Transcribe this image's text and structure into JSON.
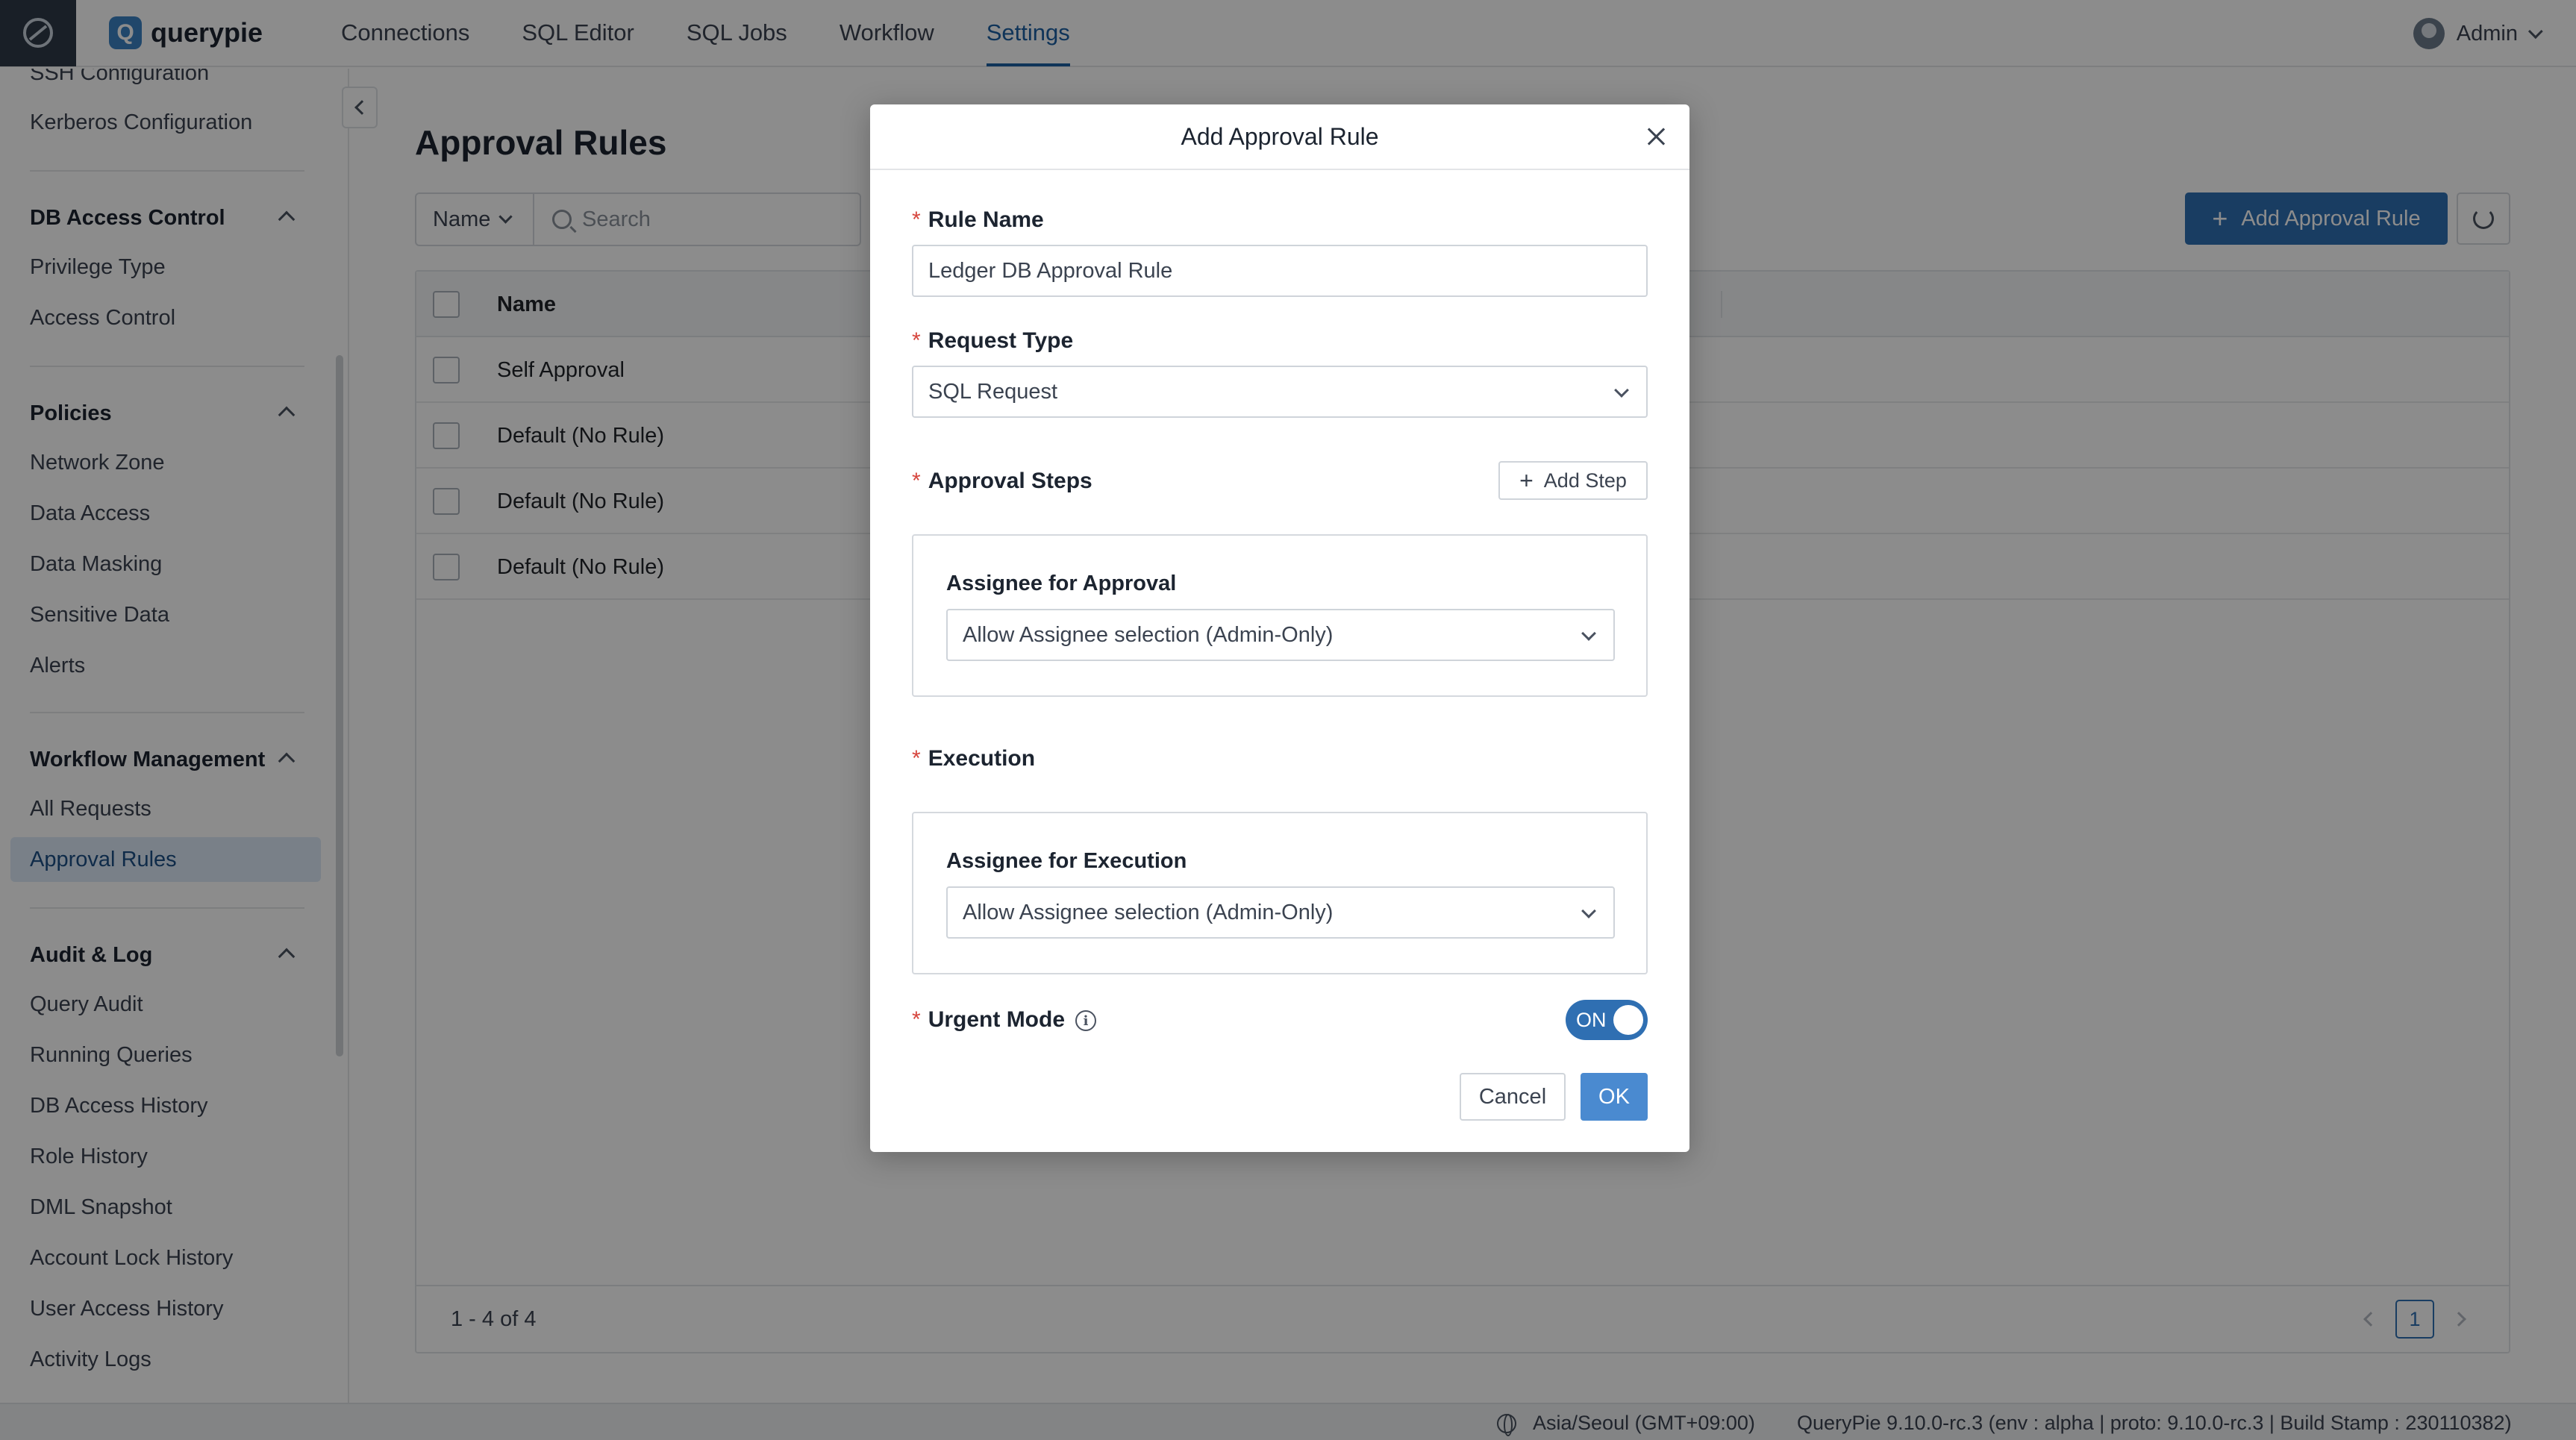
{
  "brand": {
    "name": "querypie",
    "logo_letter": "Q"
  },
  "nav": [
    {
      "label": "Connections"
    },
    {
      "label": "SQL Editor"
    },
    {
      "label": "SQL Jobs"
    },
    {
      "label": "Workflow"
    },
    {
      "label": "Settings",
      "active": true
    }
  ],
  "user": {
    "name": "Admin"
  },
  "sidebar": {
    "top_items": [
      "SSH Configuration",
      "Kerberos Configuration"
    ],
    "sections": [
      {
        "title": "DB Access Control",
        "items": [
          "Privilege Type",
          "Access Control"
        ]
      },
      {
        "title": "Policies",
        "items": [
          "Network Zone",
          "Data Access",
          "Data Masking",
          "Sensitive Data",
          "Alerts"
        ]
      },
      {
        "title": "Workflow Management",
        "items": [
          "All Requests",
          "Approval Rules"
        ]
      },
      {
        "title": "Audit & Log",
        "items": [
          "Query Audit",
          "Running Queries",
          "DB Access History",
          "Role History",
          "DML Snapshot",
          "Account Lock History",
          "User Access History",
          "Activity Logs"
        ]
      }
    ],
    "active_item": "Approval Rules"
  },
  "main": {
    "title": "Approval Rules",
    "filter": {
      "field": "Name",
      "search_placeholder": "Search"
    },
    "add_button": "Add Approval Rule",
    "table": {
      "columns": [
        "Name"
      ],
      "rows": [
        "Self Approval",
        "Default (No Rule)",
        "Default (No Rule)",
        "Default (No Rule)"
      ]
    },
    "pagination": {
      "summary": "1 - 4 of 4",
      "current_page": "1"
    }
  },
  "status_bar": {
    "timezone": "Asia/Seoul (GMT+09:00)",
    "version": "QueryPie 9.10.0-rc.3 (env : alpha | proto: 9.10.0-rc.3 | Build Stamp : 230110382)"
  },
  "modal": {
    "title": "Add Approval Rule",
    "required_mark": "*",
    "rule_name": {
      "label": "Rule Name",
      "value": "Ledger DB Approval Rule"
    },
    "request_type": {
      "label": "Request Type",
      "value": "SQL Request"
    },
    "approval_steps": {
      "label": "Approval Steps",
      "add_step": "Add Step",
      "assignee_label": "Assignee for Approval",
      "assignee_value": "Allow Assignee selection (Admin-Only)"
    },
    "execution": {
      "label": "Execution",
      "assignee_label": "Assignee for Execution",
      "assignee_value": "Allow Assignee selection (Admin-Only)"
    },
    "urgent_mode": {
      "label": "Urgent Mode",
      "toggle_label": "ON",
      "enabled": true
    },
    "cancel": "Cancel",
    "ok": "OK"
  },
  "colors": {
    "accent": "#2f6fb2",
    "required": "#d6453d",
    "active_nav": "#1c5fa3"
  }
}
